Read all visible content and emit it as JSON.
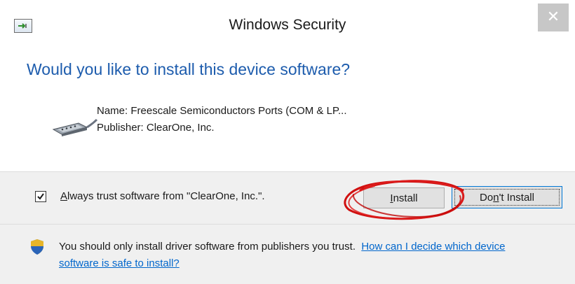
{
  "window": {
    "title": "Windows Security",
    "close_glyph": "✕"
  },
  "main": {
    "heading": "Would you like to install this device software?",
    "device_name": "Name: Freescale Semiconductors Ports (COM & LP...",
    "device_publisher": "Publisher: ClearOne, Inc."
  },
  "options": {
    "trust_checkbox_checked": true,
    "trust_label_accesskey": "A",
    "trust_label_rest": "lways trust software from \"ClearOne, Inc.\"."
  },
  "buttons": {
    "install_accesskey": "I",
    "install_rest": "nstall",
    "dont_install_pre": "Do",
    "dont_install_accesskey": "n",
    "dont_install_rest": "'t Install"
  },
  "footer": {
    "warning_text": "You should only install driver software from publishers you trust.",
    "help_link": "How can I decide which device software is safe to install?"
  },
  "icons": {
    "title": "device-installer-icon",
    "device": "serial-port-connector-icon",
    "checkbox": "checkmark-icon",
    "footer": "security-shield-icon"
  },
  "colors": {
    "heading": "#1d5cad",
    "link": "#0066cc",
    "annotation": "#d01010",
    "action_area": "#f0f0f0",
    "focus_border": "#0078d7"
  }
}
